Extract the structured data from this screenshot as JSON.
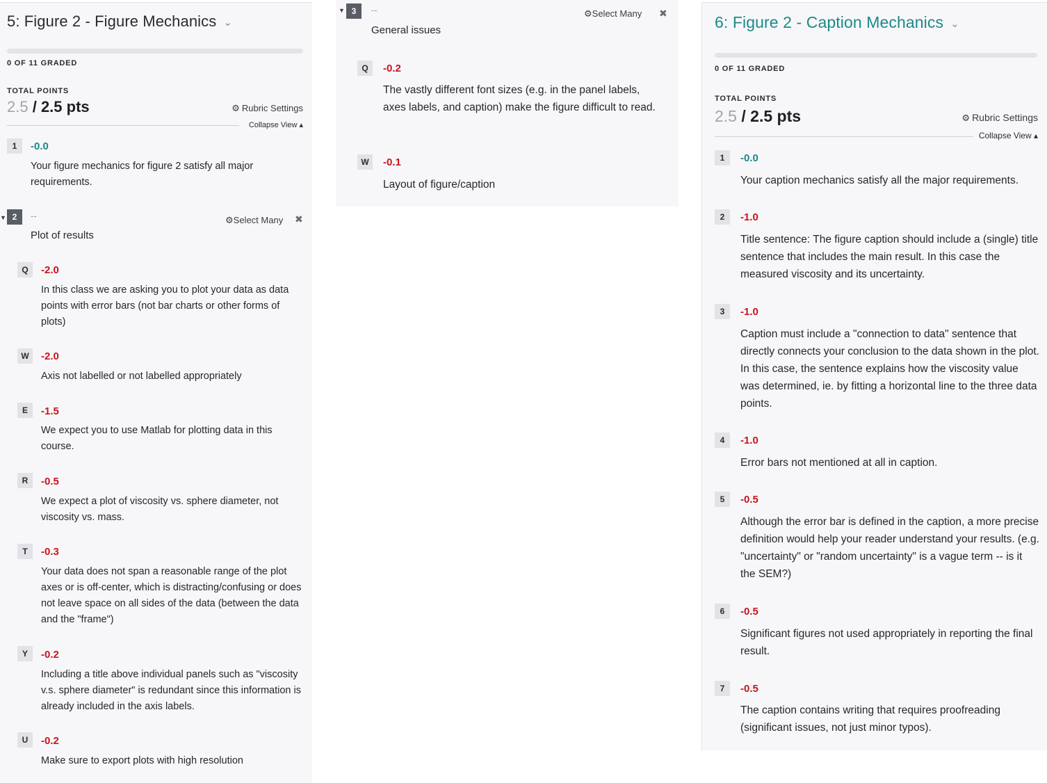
{
  "left": {
    "title": "5: Figure 2 - Figure Mechanics",
    "graded": "0 OF 11 GRADED",
    "total_points_label": "TOTAL POINTS",
    "score": "2.5",
    "max": "/ 2.5 pts",
    "rubric_settings": "Rubric Settings",
    "collapse_view": "Collapse View ▴",
    "item1": {
      "key": "1",
      "score": "-0.0",
      "text": "Your figure mechanics for figure 2 satisfy all major requirements."
    },
    "group": {
      "key": "2",
      "dash": "--",
      "title": "Plot of results",
      "select_many": "Select Many",
      "items": [
        {
          "key": "Q",
          "score": "-2.0",
          "text": "In this class we are asking you to plot your data as data points with error bars (not bar charts or other forms of plots)"
        },
        {
          "key": "W",
          "score": "-2.0",
          "text": "Axis not labelled or not labelled appropriately"
        },
        {
          "key": "E",
          "score": "-1.5",
          "text": "We expect you to use Matlab for plotting data in this course."
        },
        {
          "key": "R",
          "score": "-0.5",
          "text": "We expect a plot of viscosity vs. sphere diameter, not viscosity vs. mass."
        },
        {
          "key": "T",
          "score": "-0.3",
          "text": "Your data does not span a reasonable range of the plot axes or is off-center, which is distracting/confusing or does not leave space on all sides of the data (between the data and the \"frame\")"
        },
        {
          "key": "Y",
          "score": "-0.2",
          "text": "Including a title above individual panels such as \"viscosity v.s. sphere diameter\" is redundant since this information is already included in the axis labels."
        },
        {
          "key": "U",
          "score": "-0.2",
          "text": "Make sure to export plots with high resolution"
        }
      ]
    }
  },
  "middle": {
    "group": {
      "key": "3",
      "dash": "--",
      "title": "General issues",
      "select_many": "Select Many",
      "items": [
        {
          "key": "Q",
          "score": "-0.2",
          "text": "The vastly different font sizes (e.g. in the panel labels, axes labels, and caption) make the figure difficult to read."
        },
        {
          "key": "W",
          "score": "-0.1",
          "text": "Layout of figure/caption"
        }
      ]
    }
  },
  "right": {
    "title": "6: Figure 2 - Caption Mechanics",
    "graded": "0 OF 11 GRADED",
    "total_points_label": "TOTAL POINTS",
    "score": "2.5",
    "max": "/ 2.5 pts",
    "rubric_settings": "Rubric Settings",
    "collapse_view": "Collapse View ▴",
    "items": [
      {
        "key": "1",
        "score": "-0.0",
        "text": "Your caption mechanics satisfy all the major requirements."
      },
      {
        "key": "2",
        "score": "-1.0",
        "text": "Title sentence: The figure caption should include a (single) title sentence that includes the main result. In this case the measured viscosity and its uncertainty."
      },
      {
        "key": "3",
        "score": "-1.0",
        "text": "Caption must include a \"connection to data\" sentence that directly connects your conclusion to the data shown in the plot. In this case, the sentence explains how the viscosity value was determined, ie. by fitting a horizontal line to the three data points."
      },
      {
        "key": "4",
        "score": "-1.0",
        "text": "Error bars not mentioned at all in caption."
      },
      {
        "key": "5",
        "score": "-0.5",
        "text": "Although the error bar is defined in the caption, a more precise definition would help your reader understand your results.  (e.g. \"uncertainty\" or \"random uncertainty\" is a vague term -- is it the SEM?)"
      },
      {
        "key": "6",
        "score": "-0.5",
        "text": "Significant figures not used appropriately in reporting the final result."
      },
      {
        "key": "7",
        "score": "-0.5",
        "text": "The caption contains writing that requires proofreading (significant issues, not just minor typos)."
      }
    ]
  }
}
